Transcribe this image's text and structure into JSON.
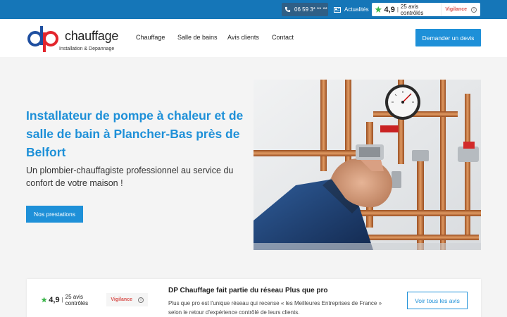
{
  "topbar": {
    "phone": "06 59 3* ** **",
    "news_label": "Actualités",
    "rating": {
      "score": "4,9",
      "separator": "|",
      "reviews": "25 avis contrôlés",
      "vigilance": "Vigilance",
      "info_glyph": "i"
    }
  },
  "header": {
    "logo": {
      "mark": "dp",
      "brand": "chauffage",
      "tagline": "Installation & Depannage"
    },
    "nav": [
      "Chauffage",
      "Salle de bains",
      "Avis clients",
      "Contact"
    ],
    "cta": "Demander un devis"
  },
  "hero": {
    "title": "Installateur de pompe à chaleur et de salle de bain à Plancher-Bas près de Belfort",
    "subtitle": "Un plombier-chauffagiste professionnel au service du confort de votre maison !",
    "button": "Nos prestations",
    "image_alt": "plumber-hand-adjusting-pipes"
  },
  "card": {
    "rating": {
      "score": "4,9",
      "separator": "|",
      "reviews": "25 avis contrôlés",
      "vigilance": "Vigilance",
      "info_glyph": "i"
    },
    "title": "DP Chauffage fait partie du réseau Plus que pro",
    "description": "Plus que pro est l'unique réseau qui recense « les Meilleures Entreprises de France » selon le retour d'expérience contrôlé de leurs clients.",
    "button": "Voir tous les avis"
  },
  "colors": {
    "primary": "#1e90d8",
    "topbar": "#1576b8",
    "logo_red": "#e3262d",
    "logo_blue": "#1f4fa0",
    "vigilance": "#d9534f",
    "star_green": "#3bb54a"
  }
}
